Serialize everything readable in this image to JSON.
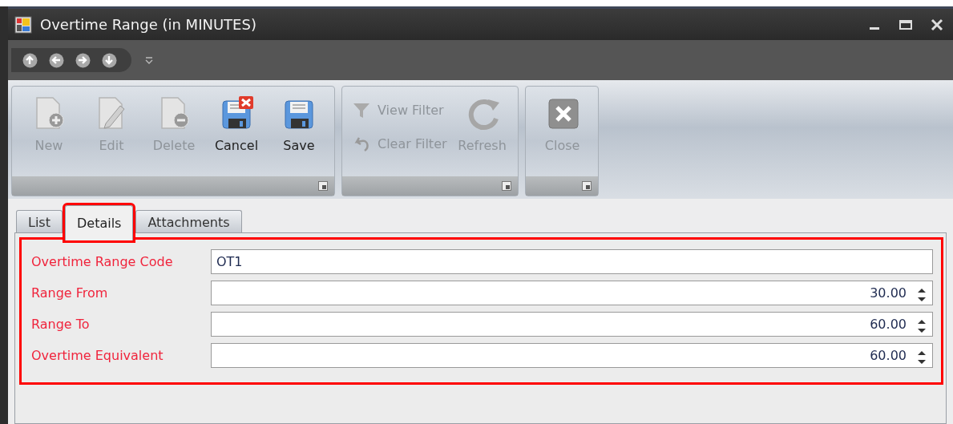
{
  "window": {
    "title": "Overtime Range (in MINUTES)"
  },
  "ribbon_groups": [
    {
      "buttons": [
        {
          "label": "New",
          "disabled": true,
          "kind": "large"
        },
        {
          "label": "Edit",
          "disabled": true,
          "kind": "large"
        },
        {
          "label": "Delete",
          "disabled": true,
          "kind": "large"
        },
        {
          "label": "Cancel",
          "disabled": false,
          "kind": "large"
        },
        {
          "label": "Save",
          "disabled": false,
          "kind": "large"
        }
      ]
    },
    {
      "buttons": [
        {
          "label": "View Filter",
          "disabled": true,
          "kind": "small"
        },
        {
          "label": "Clear Filter",
          "disabled": true,
          "kind": "small"
        },
        {
          "label": "Refresh",
          "disabled": true,
          "kind": "large"
        }
      ]
    },
    {
      "buttons": [
        {
          "label": "Close",
          "disabled": true,
          "kind": "large"
        }
      ]
    }
  ],
  "tabs": [
    {
      "label": "List",
      "selected": false,
      "highlighted": false
    },
    {
      "label": "Details",
      "selected": true,
      "highlighted": true
    },
    {
      "label": "Attachments",
      "selected": false,
      "highlighted": false
    }
  ],
  "form": {
    "highlighted": true,
    "fields": [
      {
        "label": "Overtime Range Code",
        "required": true,
        "kind": "text",
        "value": "OT1"
      },
      {
        "label": "Range From",
        "required": true,
        "kind": "spin",
        "value": "30.00"
      },
      {
        "label": "Range To",
        "required": true,
        "kind": "spin",
        "value": "60.00"
      },
      {
        "label": "Overtime Equivalent",
        "required": true,
        "kind": "spin",
        "value": "60.00"
      }
    ]
  }
}
